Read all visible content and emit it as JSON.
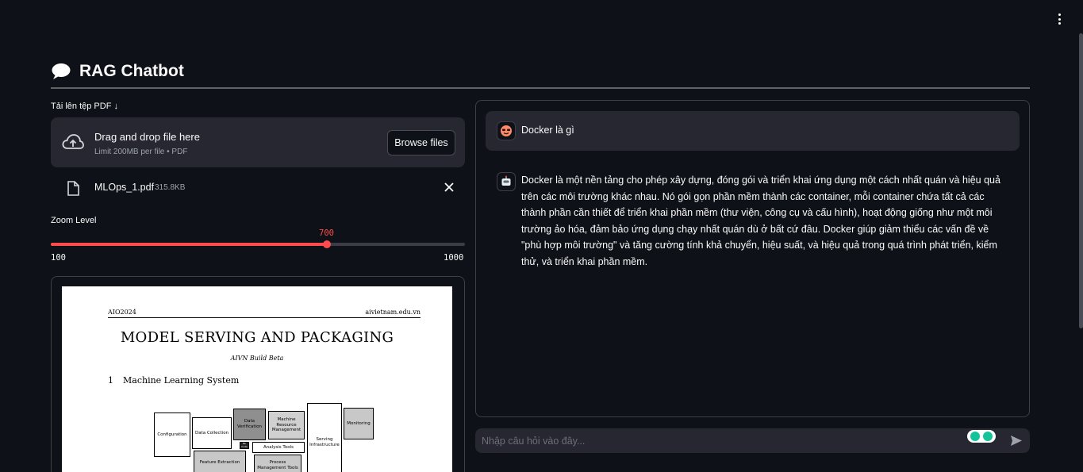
{
  "app": {
    "title": "RAG Chatbot",
    "title_icon": "speech-balloon-icon",
    "menu_icon": "kebab-menu-icon"
  },
  "uploader": {
    "label": "Tải lên tệp PDF ↓",
    "drop_text": "Drag and drop file here",
    "limit_text": "Limit 200MB per file • PDF",
    "browse_label": "Browse files",
    "icon": "cloud-upload-icon"
  },
  "uploaded_file": {
    "name": "MLOps_1.pdf",
    "size": "315.8KB",
    "icon": "file-icon",
    "remove_icon": "close-icon"
  },
  "zoom": {
    "label": "Zoom Level",
    "value": "700",
    "min": "100",
    "max": "1000",
    "value_num": 700,
    "min_num": 100,
    "max_num": 1000,
    "accent": "#ff4b4b"
  },
  "pdf_preview": {
    "header_left": "AIO2024",
    "header_right": "aivietnam.edu.vn",
    "title": "MODEL SERVING AND PACKAGING",
    "subtitle": "AIVN Build Beta",
    "section_num": "1",
    "section_title": "Machine Learning System",
    "diagram": {
      "configuration": "Configuration",
      "data_collection": "Data Collection",
      "data_verification": "Data Verification",
      "ml_code": "ML Code",
      "machine_resource": "Machine Resource Management",
      "serving": "Serving Infrastructure",
      "monitoring": "Monitoring",
      "analysis_tools": "Analysis Tools",
      "feature_extraction": "Feature Extraction",
      "process_mgmt": "Process Management Tools"
    }
  },
  "chat": {
    "messages": [
      {
        "role": "user",
        "avatar": "user-avatar-icon",
        "text": "Docker là gì"
      },
      {
        "role": "assistant",
        "avatar": "bot-avatar-icon",
        "text": "Docker là một nền tảng cho phép xây dựng, đóng gói và triển khai ứng dụng một cách nhất quán và hiệu quả trên các môi trường khác nhau. Nó gói gọn phần mềm thành các container, mỗi container chứa tất cả các thành phần cần thiết để triển khai phần mềm (thư viện, công cụ và cấu hình), hoạt động giống như một môi trường ảo hóa, đảm bảo ứng dụng chạy nhất quán dù ở bất cứ đâu. Docker giúp giảm thiểu các vấn đề về \"phù hợp môi trường\" và tăng cường tính khả chuyển, hiệu suất, và hiệu quả trong quá trình phát triển, kiểm thử, và triển khai phần mềm."
      }
    ],
    "input_placeholder": "Nhập câu hỏi vào đây...",
    "send_icon": "send-icon",
    "extension_icon": "grammarly-icon"
  }
}
